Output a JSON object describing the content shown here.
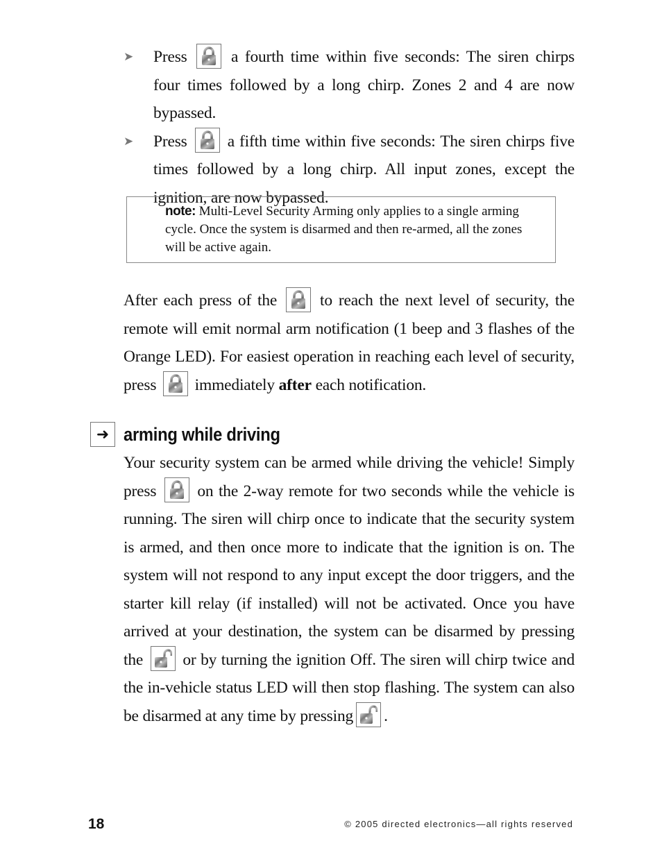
{
  "bullets": [
    {
      "marker": "➤",
      "before": "Press",
      "icon": "lock-closed-icon",
      "after": "a fourth time within five seconds: The siren chirps four times followed by a long chirp. Zones 2 and 4 are now bypassed."
    },
    {
      "marker": "➤",
      "before": "Press",
      "icon": "lock-closed-icon",
      "after": "a fifth time within five seconds: The siren chirps five times followed by a long chirp. All input zones, except the ignition, are now bypassed."
    }
  ],
  "note": {
    "label": "note:",
    "text": "Multi-Level Security Arming only applies to a single arming cycle. Once the system is disarmed and then re-armed, all the zones will be active again."
  },
  "paragraph1": {
    "part1": "After each press of the",
    "part2": "to reach the next level of security, the remote will emit normal arm notification (1 beep and 3 flashes of the Orange LED). For easiest operation in reaching each level of security, press",
    "part3": "immediately",
    "bold_word": "after",
    "part4": "each notification."
  },
  "section": {
    "arrow_icon": "➜",
    "title": "arming while driving"
  },
  "paragraph2": {
    "part1": "Your security system can be armed while driving the vehicle! Simply press",
    "part2": "on the 2-way remote for two seconds while the vehicle is running. The siren will chirp once to indicate that the security system is armed, and then once more to indicate that the ignition is on. The system will not respond to any input except the door triggers, and the starter kill relay (if installed) will not be activated. Once you have arrived at your destination, the system can be disarmed by pressing the",
    "part3": "or by turning the ignition Off. The siren will chirp twice and the in-vehicle status LED will then stop flashing. The system can also be disarmed at any time by pressing",
    "part4": "."
  },
  "footer": {
    "page_number": "18",
    "copyright": "© 2005 directed electronics—all rights reserved"
  }
}
